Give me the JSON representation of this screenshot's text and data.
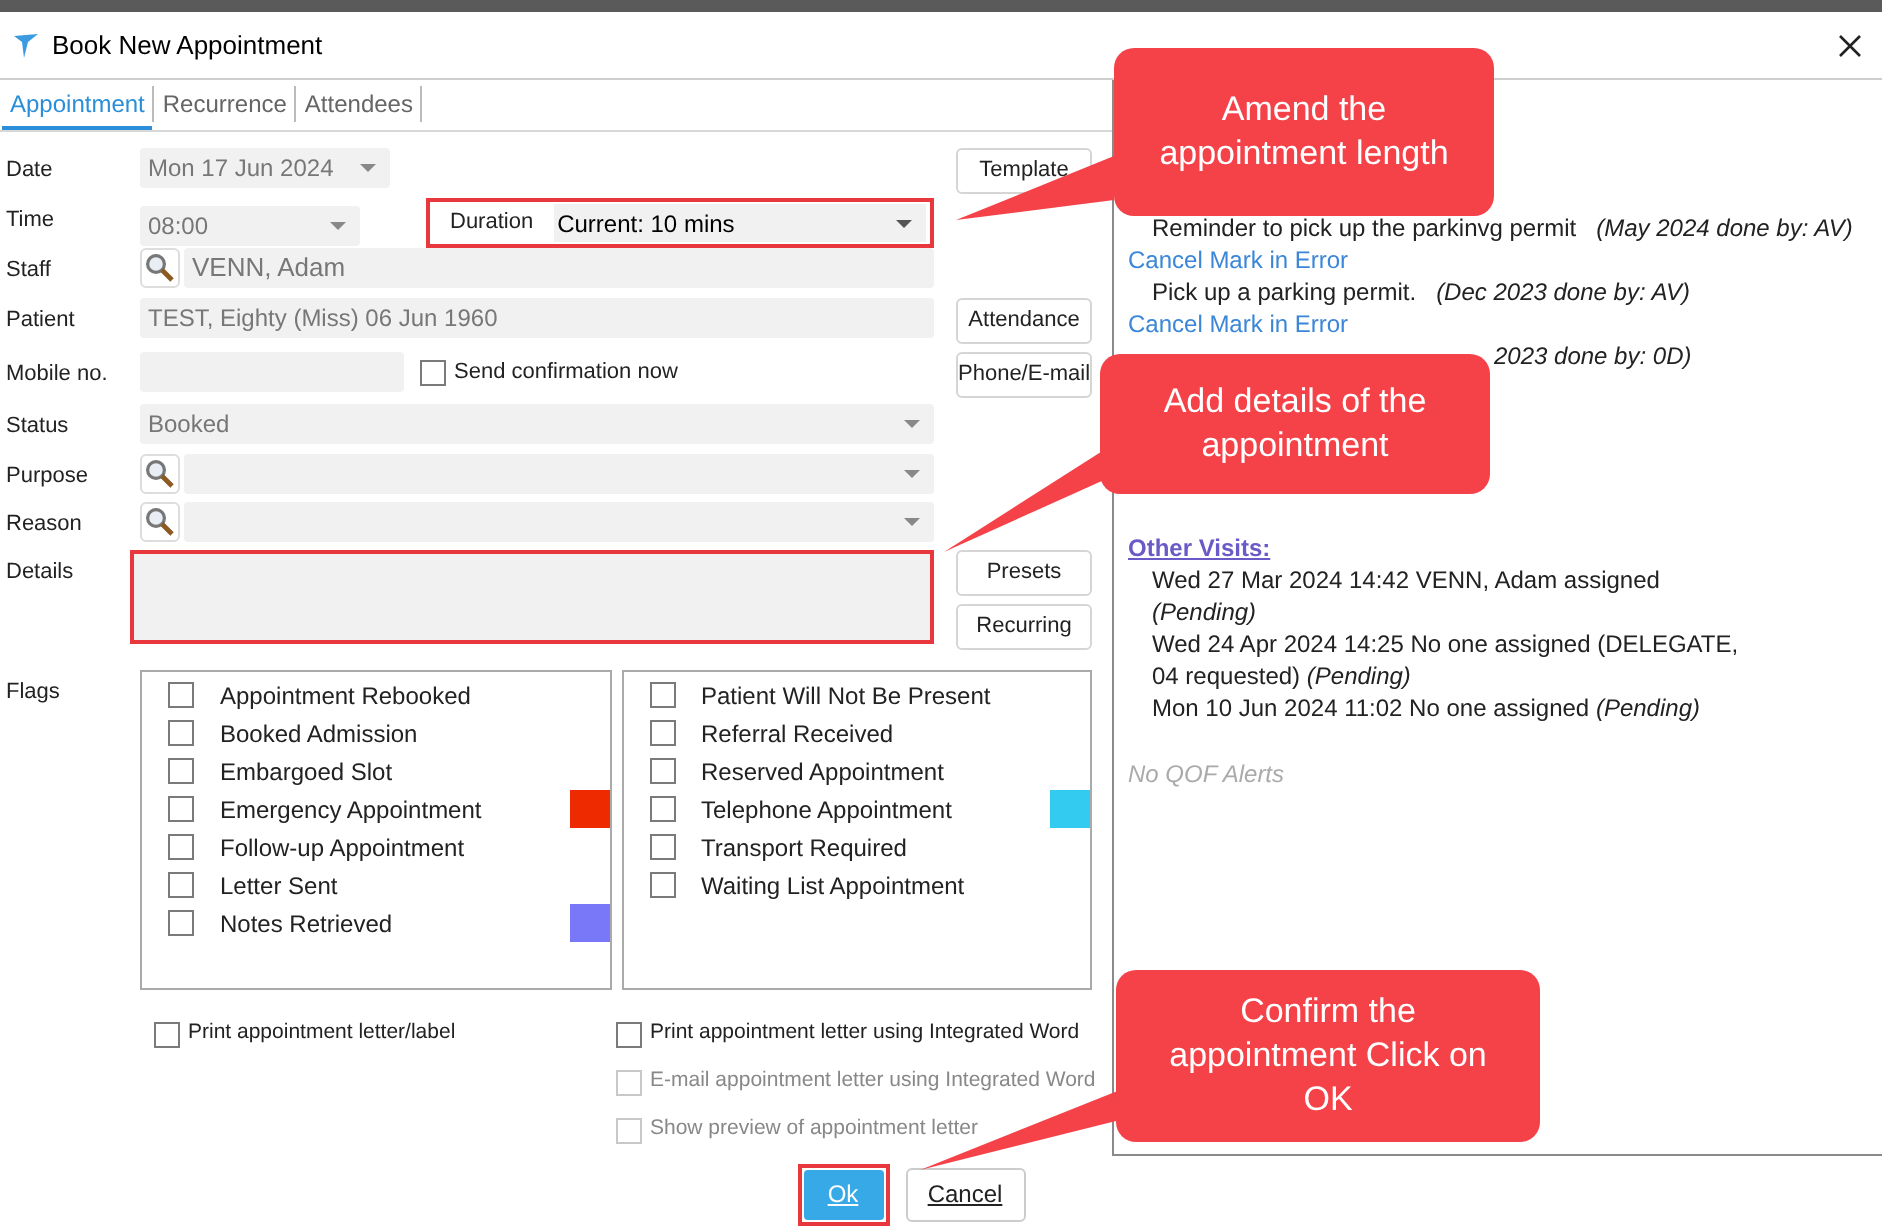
{
  "window": {
    "title": "Book New Appointment"
  },
  "tabs": [
    {
      "label": "Appointment",
      "selected": true
    },
    {
      "label": "Recurrence",
      "selected": false
    },
    {
      "label": "Attendees",
      "selected": false
    }
  ],
  "form": {
    "date": {
      "label": "Date",
      "value": "Mon 17 Jun 2024"
    },
    "time": {
      "label": "Time",
      "value": "08:00"
    },
    "duration": {
      "label": "Duration",
      "value": "Current: 10 mins"
    },
    "staff": {
      "label": "Staff",
      "value": "VENN, Adam"
    },
    "patient": {
      "label": "Patient",
      "value": "TEST, Eighty (Miss) 06 Jun 1960"
    },
    "mobile": {
      "label": "Mobile no.",
      "send_confirmation": {
        "label": "Send confirmation now",
        "checked": false
      }
    },
    "status": {
      "label": "Status",
      "value": "Booked"
    },
    "purpose": {
      "label": "Purpose"
    },
    "reason": {
      "label": "Reason"
    },
    "details": {
      "label": "Details"
    },
    "flags_label": "Flags"
  },
  "side_buttons": [
    "Template",
    "Attendance",
    "Phone/E-mail",
    "Presets",
    "Recurring"
  ],
  "flags": [
    [
      {
        "label": "Appointment Rebooked",
        "checked": false
      },
      {
        "label": "Booked Admission",
        "checked": false
      },
      {
        "label": "Embargoed Slot",
        "checked": false
      },
      {
        "label": "Emergency Appointment",
        "checked": false,
        "color": "#ee2a00"
      },
      {
        "label": "Follow-up Appointment",
        "checked": false
      },
      {
        "label": "Letter Sent",
        "checked": false
      },
      {
        "label": "Notes Retrieved",
        "checked": false,
        "color": "#7878f8"
      }
    ],
    [
      {
        "label": "Patient Will Not Be Present",
        "checked": false
      },
      {
        "label": "Referral Received",
        "checked": false
      },
      {
        "label": "Reserved Appointment",
        "checked": false
      },
      {
        "label": "Telephone Appointment",
        "checked": false,
        "color": "#33ccf0"
      },
      {
        "label": "Transport Required",
        "checked": false
      },
      {
        "label": "Waiting List Appointment",
        "checked": false
      }
    ]
  ],
  "letter_options": [
    {
      "label": "Print appointment letter/label",
      "checked": false,
      "disabled": false
    },
    {
      "label": "Print appointment letter using Integrated Word",
      "checked": false,
      "disabled": false
    },
    {
      "label": "E-mail appointment letter using Integrated Word",
      "checked": false,
      "disabled": true
    },
    {
      "label": "Show preview of appointment letter",
      "checked": false,
      "disabled": true
    }
  ],
  "side_panel": {
    "lines": [
      {
        "kind": "task",
        "text": "Reminder to pick up the parkinvg permit",
        "note": "(May 2024 done by: AV)"
      },
      {
        "kind": "link",
        "text": "Cancel Mark in Error"
      },
      {
        "kind": "task",
        "text": "Pick up a parking permit.",
        "note": "(Dec 2023 done by: AV)"
      },
      {
        "kind": "link",
        "text": "Cancel Mark in Error"
      },
      {
        "kind": "partial",
        "note": "2023 done by: 0D)"
      }
    ],
    "other_visits": {
      "heading": "Other Visits:",
      "items": [
        {
          "text": "Wed 27 Mar 2024 14:42 VENN, Adam assigned",
          "status": "(Pending)"
        },
        {
          "text": "Wed 24 Apr 2024 14:25 No one assigned (DELEGATE, 04 requested)",
          "status": "(Pending)"
        },
        {
          "text": "Mon 10 Jun 2024 11:02 No one assigned",
          "status": "(Pending)"
        }
      ]
    },
    "qof": "No QOF Alerts"
  },
  "footer_buttons": [
    {
      "label": "Ok",
      "kind": "primary"
    },
    {
      "label": "Cancel",
      "kind": "secondary"
    }
  ],
  "callouts": [
    "Amend the appointment length",
    "Add details of the appointment",
    "Confirm the appointment Click on OK"
  ]
}
